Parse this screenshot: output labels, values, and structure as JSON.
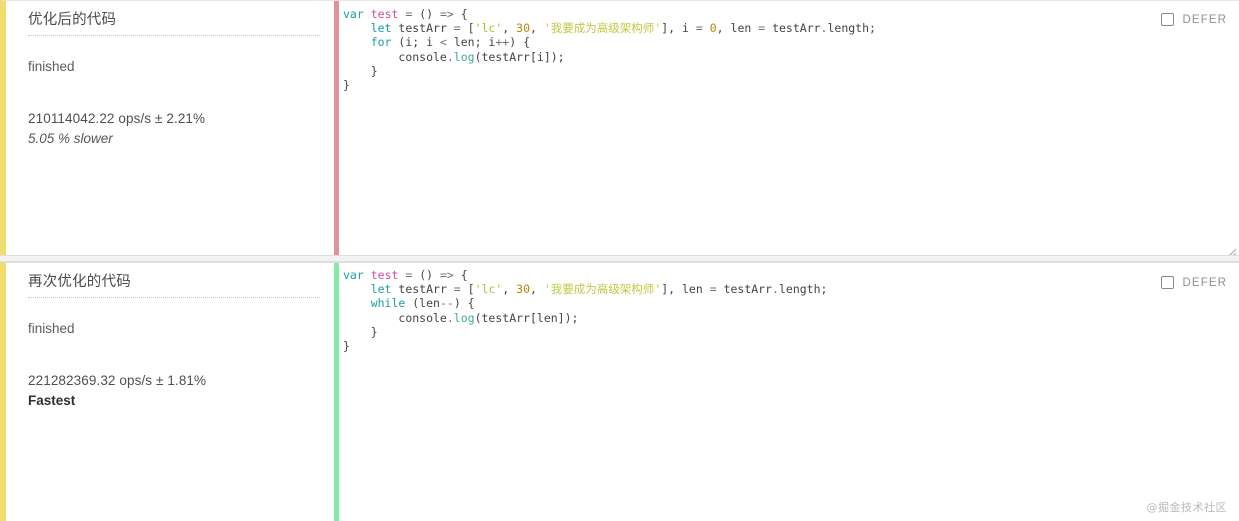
{
  "colors": {
    "case_accent_left": "#f0dd6e",
    "code_accent_slower": "#e0939b",
    "code_accent_fastest": "#86e9a7",
    "page_background": "#ffffff",
    "keyword": "#1b9e9f",
    "function_name": "#d64ca0",
    "string": "#b5bd3a",
    "number": "#b8860b"
  },
  "cases": [
    {
      "title": "优化后的代码",
      "status": "finished",
      "ops": "210114042.22 ops/s ± 2.21%",
      "rank": "5.05 % slower",
      "rank_kind": "slower",
      "defer_label": "DEFER",
      "defer_checked": false,
      "code_lines": [
        "var test = () => {",
        "    let testArr = ['lc', 30, '我要成为高级架构师'], i = 0, len = testArr.length;",
        "    for (i; i < len; i++) {",
        "        console.log(testArr[i]);",
        "    }",
        "}"
      ]
    },
    {
      "title": "再次优化的代码",
      "status": "finished",
      "ops": "221282369.32 ops/s ± 1.81%",
      "rank": "Fastest",
      "rank_kind": "fastest",
      "defer_label": "DEFER",
      "defer_checked": false,
      "code_lines": [
        "var test = () => {",
        "    let testArr = ['lc', 30, '我要成为高级架构师'], len = testArr.length;",
        "    while (len--) {",
        "        console.log(testArr[len]);",
        "    }",
        "}"
      ]
    }
  ],
  "watermark": "@掘金技术社区"
}
